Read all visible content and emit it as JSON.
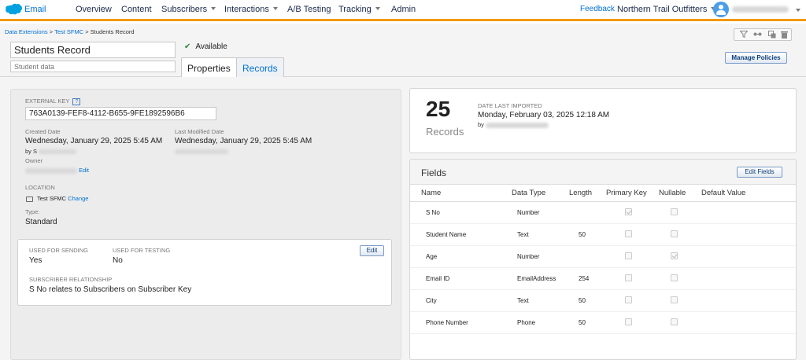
{
  "nav": {
    "app_name": "Email",
    "items": [
      {
        "label": "Overview",
        "dropdown": false
      },
      {
        "label": "Content",
        "dropdown": false
      },
      {
        "label": "Subscribers",
        "dropdown": true
      },
      {
        "label": "Interactions",
        "dropdown": true
      },
      {
        "label": "A/B Testing",
        "dropdown": false
      },
      {
        "label": "Tracking",
        "dropdown": true
      },
      {
        "label": "Admin",
        "dropdown": false
      }
    ],
    "feedback": "Feedback",
    "org": "Northern Trail Outfitters",
    "accent_color": "#f19900",
    "brand_color": "#0070d2"
  },
  "header": {
    "breadcrumb": {
      "first": "Data Extensions",
      "second": "Test SFMC",
      "current": "Students Record",
      "separator": ">"
    },
    "title_value": "Students Record",
    "description_placeholder": "Student data",
    "status": "Available",
    "tabs": [
      {
        "label": "Properties",
        "active": true
      },
      {
        "label": "Records",
        "active": false
      }
    ],
    "manage_policies": "Manage Policies",
    "toolbar_icons": [
      "filter-icon",
      "link-icon",
      "copy-icon",
      "trash-icon"
    ]
  },
  "properties": {
    "external_key_label": "EXTERNAL KEY",
    "help_glyph": "?",
    "external_key": "763A0139-FEF8-4112-B655-9FE1892596B6",
    "created_label": "Created Date",
    "created_date": "Wednesday, January 29, 2025 5:45 AM",
    "created_by_prefix": "by S",
    "modified_label": "Last Modified Date",
    "modified_date": "Wednesday, January 29, 2025 5:45 AM",
    "owner_label": "Owner",
    "owner_edit": "Edit",
    "location_label": "LOCATION",
    "location_folder": "Test SFMC",
    "location_change": "Change",
    "type_label": "Type:",
    "type_value": "Standard",
    "sending": {
      "used_for_sending_label": "USED FOR SENDING",
      "used_for_sending": "Yes",
      "used_for_testing_label": "USED FOR TESTING",
      "used_for_testing": "No",
      "edit": "Edit",
      "relationship_label": "SUBSCRIBER RELATIONSHIP",
      "relationship": "S No relates to Subscribers on Subscriber Key"
    }
  },
  "summary": {
    "record_count": "25",
    "record_label": "Records",
    "imported_label": "DATE LAST IMPORTED",
    "imported_date": "Monday, February 03, 2025 12:18 AM",
    "imported_by_prefix": "by"
  },
  "fields": {
    "title": "Fields",
    "edit_button": "Edit Fields",
    "columns": [
      "Name",
      "Data Type",
      "Length",
      "Primary Key",
      "Nullable",
      "Default Value"
    ],
    "rows": [
      {
        "name": "S No",
        "type": "Number",
        "length": "",
        "primary": true,
        "nullable": false
      },
      {
        "name": "Student Name",
        "type": "Text",
        "length": "50",
        "primary": false,
        "nullable": false
      },
      {
        "name": "Age",
        "type": "Number",
        "length": "",
        "primary": false,
        "nullable": true
      },
      {
        "name": "Email ID",
        "type": "EmailAddress",
        "length": "254",
        "primary": false,
        "nullable": false
      },
      {
        "name": "City",
        "type": "Text",
        "length": "50",
        "primary": false,
        "nullable": false
      },
      {
        "name": "Phone Number",
        "type": "Phone",
        "length": "50",
        "primary": false,
        "nullable": false
      }
    ]
  }
}
